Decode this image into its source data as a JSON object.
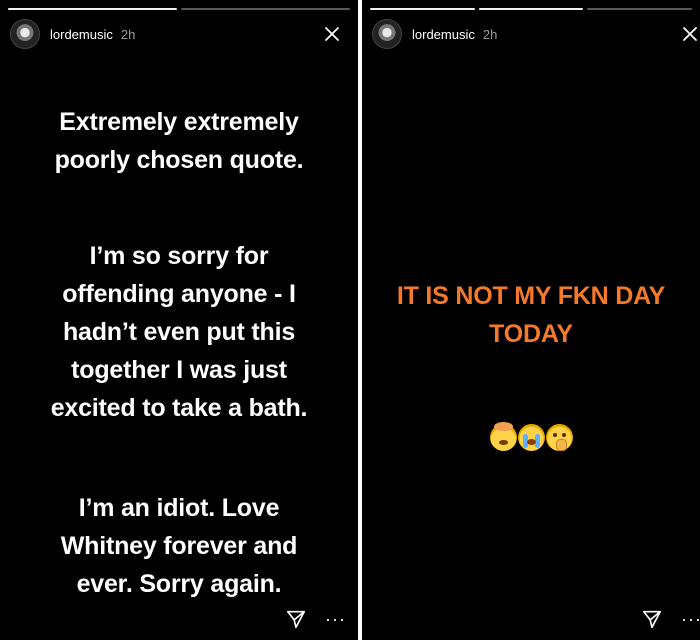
{
  "stories": [
    {
      "username": "lordemusic",
      "time": "2h",
      "blocks": [
        "Extremely extremely\npoorly chosen quote.",
        "I’m so sorry for\noffending anyone - I\nhadn’t even put this\ntogether I was just\nexcited to take a bath.",
        "I’m an idiot. Love\nWhitney forever and\never. Sorry again."
      ],
      "icons": {
        "avatar": "avatar-icon",
        "close": "close-icon",
        "send": "send-icon",
        "more": "more-icon"
      }
    },
    {
      "username": "lordemusic",
      "time": "2h",
      "highlight_text": "IT IS NOT MY FKN DAY\nTODAY",
      "emojis": [
        "exploding-head",
        "loudly-crying-face",
        "shushing-face"
      ],
      "accent_color": "#F47A2A",
      "icons": {
        "avatar": "avatar-icon",
        "close": "close-icon",
        "send": "send-icon",
        "more": "more-icon"
      }
    }
  ]
}
